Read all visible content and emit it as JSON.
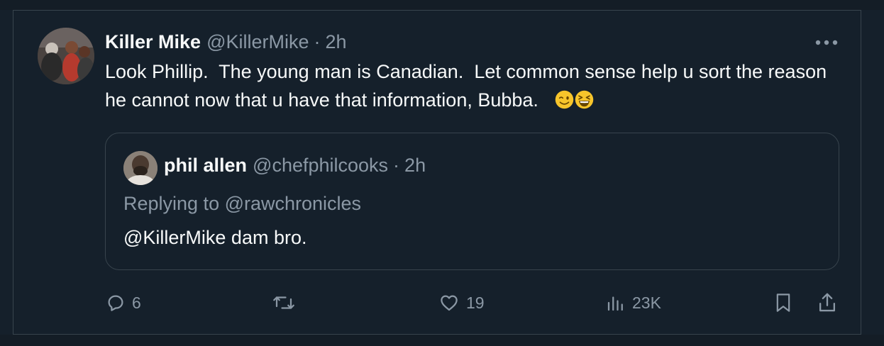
{
  "tweet": {
    "author_name": "Killer Mike",
    "handle": "@KillerMike",
    "separator": "·",
    "time": "2h",
    "text": "Look Phillip.  The young man is Canadian.  Let common sense help u sort the reason he cannot now that u have that information, Bubba.",
    "emojis": [
      "winking-face-emoji",
      "grinning-squinting-face-emoji"
    ]
  },
  "quote": {
    "author_name": "phil allen",
    "handle": "@chefphilcooks",
    "separator": "·",
    "time": "2h",
    "replying_to": "Replying to @rawchronicles",
    "text": "@KillerMike dam bro."
  },
  "actions": {
    "reply_count": "6",
    "retweet_count": "",
    "like_count": "19",
    "views_count": "23K"
  },
  "icons": {
    "more": "more-icon",
    "reply": "reply-icon",
    "retweet": "retweet-icon",
    "like": "heart-icon",
    "views": "views-icon",
    "bookmark": "bookmark-icon",
    "share": "share-icon"
  },
  "colors": {
    "background": "#15202b",
    "text_primary": "#f7f9f9",
    "text_secondary": "#8b98a5",
    "border": "#38444d",
    "emoji": "#f7c52b"
  }
}
